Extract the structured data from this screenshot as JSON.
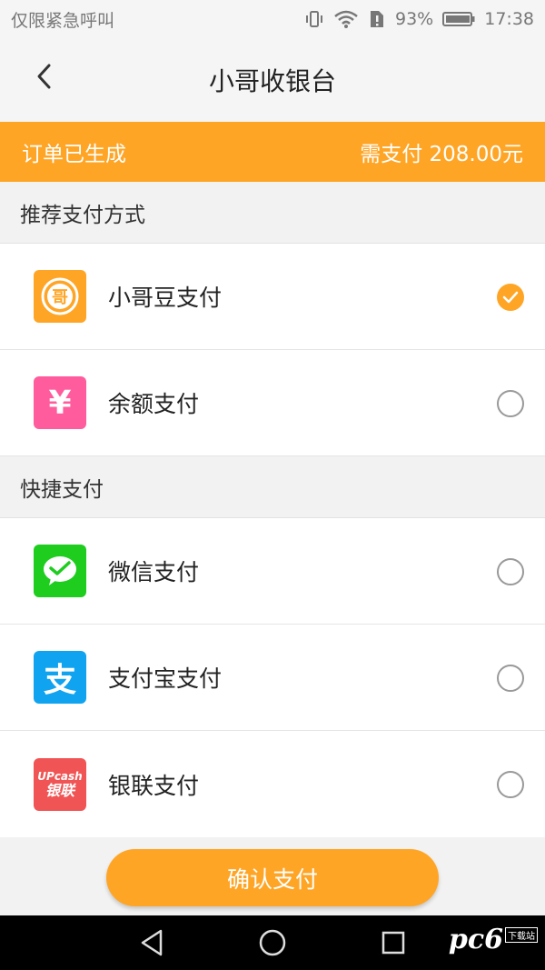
{
  "status_bar": {
    "carrier": "仅限紧急呼叫",
    "battery": "93%",
    "time": "17:38"
  },
  "header": {
    "title": "小哥收银台",
    "back_icon": "chevron-left-icon"
  },
  "order": {
    "status": "订单已生成",
    "amount_text": "需支付 208.00元"
  },
  "sections": {
    "recommended": "推荐支付方式",
    "quick": "快捷支付"
  },
  "payment_methods": [
    {
      "label": "小哥豆支付",
      "icon": "xiaoge-bean-icon",
      "color": "#ffa526",
      "selected": true
    },
    {
      "label": "余额支付",
      "icon": "yuan-icon",
      "color": "#ff5c9d",
      "selected": false
    },
    {
      "label": "微信支付",
      "icon": "wechat-icon",
      "color": "#1fcd1f",
      "selected": false
    },
    {
      "label": "支付宝支付",
      "icon": "alipay-icon",
      "color": "#10a3f0",
      "selected": false
    },
    {
      "label": "银联支付",
      "icon": "unionpay-icon",
      "color": "#f05454",
      "selected": false
    }
  ],
  "icon_text": {
    "bean": "哥",
    "yuan": "¥",
    "alipay": "支",
    "unionpay_top": "UPcash",
    "unionpay_bottom": "银联"
  },
  "confirm_label": "确认支付",
  "watermark": {
    "brand": "pc6",
    "sub": "下载站"
  },
  "colors": {
    "accent": "#ffa526",
    "background": "#f2f2f2"
  }
}
